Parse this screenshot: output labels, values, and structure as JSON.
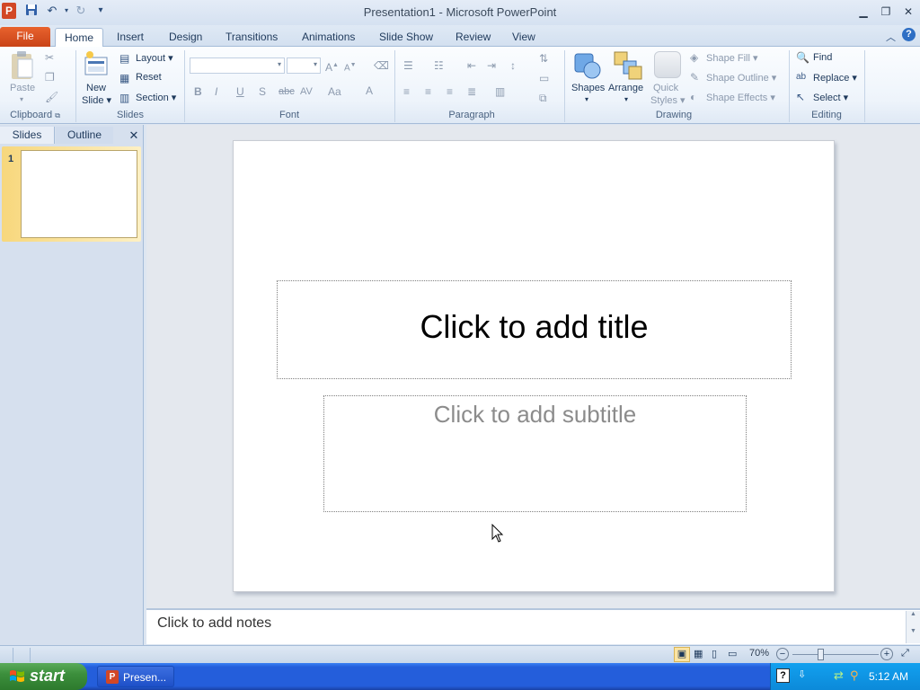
{
  "window": {
    "title": "Presentation1  -  Microsoft PowerPoint",
    "app_icon": "P"
  },
  "quick_access": {
    "save": "save-icon",
    "undo": "undo-icon",
    "redo": "redo-icon",
    "customize": "customize-qat-icon"
  },
  "tabs": [
    "File",
    "Home",
    "Insert",
    "Design",
    "Transitions",
    "Animations",
    "Slide Show",
    "Review",
    "View"
  ],
  "ribbon": {
    "clipboard": {
      "label": "Clipboard",
      "paste": "Paste"
    },
    "slides": {
      "label": "Slides",
      "new_slide_1": "New",
      "new_slide_2": "Slide",
      "layout": "Layout",
      "reset": "Reset",
      "section": "Section"
    },
    "font": {
      "label": "Font",
      "bold": "B",
      "italic": "I",
      "underline": "U",
      "shadow": "S",
      "strike": "abc",
      "spacing": "AV",
      "case": "Aa",
      "grow": "A",
      "shrink": "A",
      "color": "A"
    },
    "paragraph": {
      "label": "Paragraph"
    },
    "drawing": {
      "label": "Drawing",
      "shapes": "Shapes",
      "arrange": "Arrange",
      "quick_styles_1": "Quick",
      "quick_styles_2": "Styles",
      "shape_fill": "Shape Fill",
      "shape_outline": "Shape Outline",
      "shape_effects": "Shape Effects"
    },
    "editing": {
      "label": "Editing",
      "find": "Find",
      "replace": "Replace",
      "select": "Select"
    }
  },
  "pane": {
    "slides_tab": "Slides",
    "outline_tab": "Outline",
    "thumb_number": "1"
  },
  "slide": {
    "title_placeholder": "Click to add title",
    "subtitle_placeholder": "Click to add subtitle"
  },
  "notes": {
    "placeholder": "Click to add notes"
  },
  "status": {
    "zoom": "70%"
  },
  "taskbar": {
    "start": "start",
    "task_item": "Presen...",
    "clock": "5:12 AM"
  }
}
